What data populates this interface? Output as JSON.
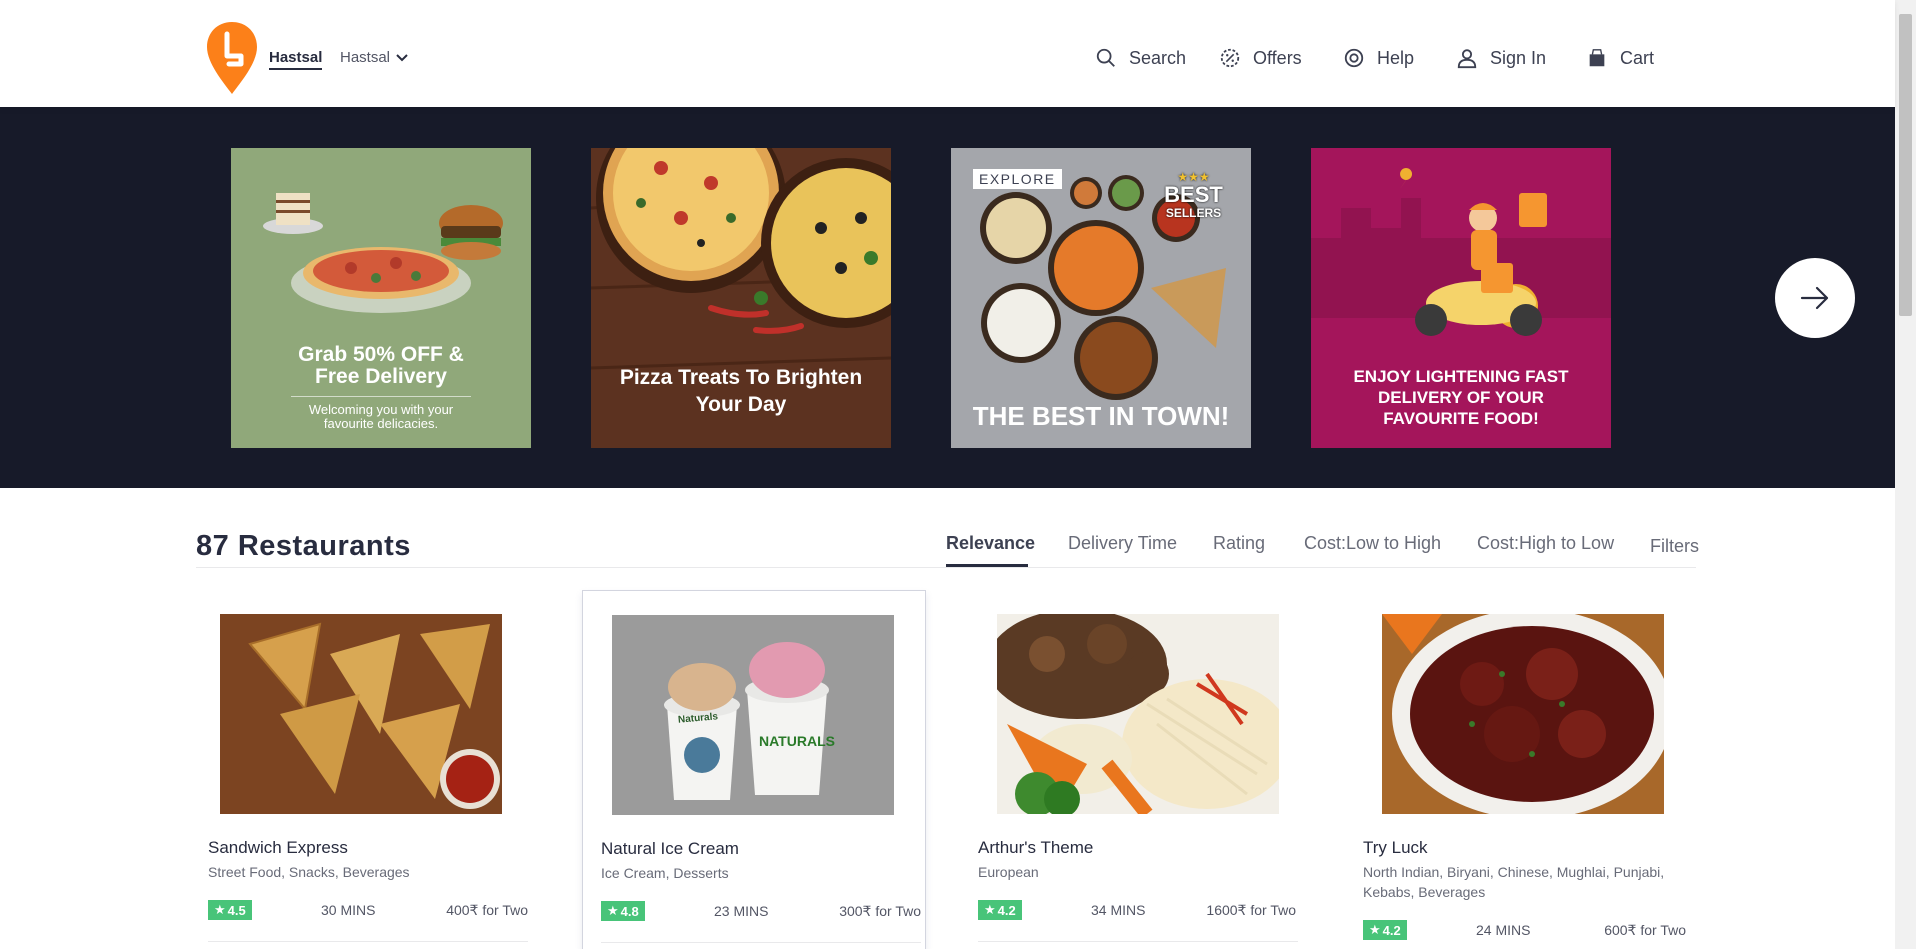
{
  "header": {
    "location_primary": "Hastsal",
    "location_secondary": "Hastsal",
    "nav": {
      "search": "Search",
      "offers": "Offers",
      "help": "Help",
      "signin": "Sign In",
      "cart": "Cart"
    }
  },
  "banner": {
    "cards": [
      {
        "line1": "Grab 50% OFF &",
        "line2": "Free Delivery",
        "sub1": "Welcoming you with your",
        "sub2": "favourite delicacies."
      },
      {
        "line1": "Pizza Treats To Brighten",
        "line2": "Your Day"
      },
      {
        "tag": "EXPLORE",
        "badge1": "BEST",
        "badge2": "SELLERS",
        "line1": "THE BEST IN TOWN!"
      },
      {
        "line1": "ENJOY LIGHTENING FAST",
        "line2": "DELIVERY OF YOUR",
        "line3": "FAVOURITE FOOD!"
      }
    ]
  },
  "restaurants_header": {
    "count": "87 Restaurants",
    "sorts": [
      "Relevance",
      "Delivery Time",
      "Rating",
      "Cost:Low to High",
      "Cost:High to Low"
    ],
    "filters": "Filters"
  },
  "restaurants": [
    {
      "name": "Sandwich Express",
      "cuisine": "Street Food, Snacks, Beverages",
      "rating": "4.5",
      "eta": "30 MINS",
      "cost": "400₹ for Two"
    },
    {
      "name": "Natural Ice Cream",
      "cuisine": "Ice Cream, Desserts",
      "rating": "4.8",
      "eta": "23 MINS",
      "cost": "300₹ for Two",
      "brand1": "Naturals",
      "brand2": "NATURALS"
    },
    {
      "name": "Arthur's Theme",
      "cuisine": "European",
      "rating": "4.2",
      "eta": "34 MINS",
      "cost": "1600₹ for Two"
    },
    {
      "name": "Try Luck",
      "cuisine": "North Indian, Biryani, Chinese, Mughlai, Punjabi, Kebabs, Beverages",
      "rating": "4.2",
      "eta": "24 MINS",
      "cost": "600₹ for Two"
    }
  ],
  "colors": {
    "brand": "#fc8019",
    "banner_bg": "#171a29",
    "rating_green": "#48c479"
  }
}
